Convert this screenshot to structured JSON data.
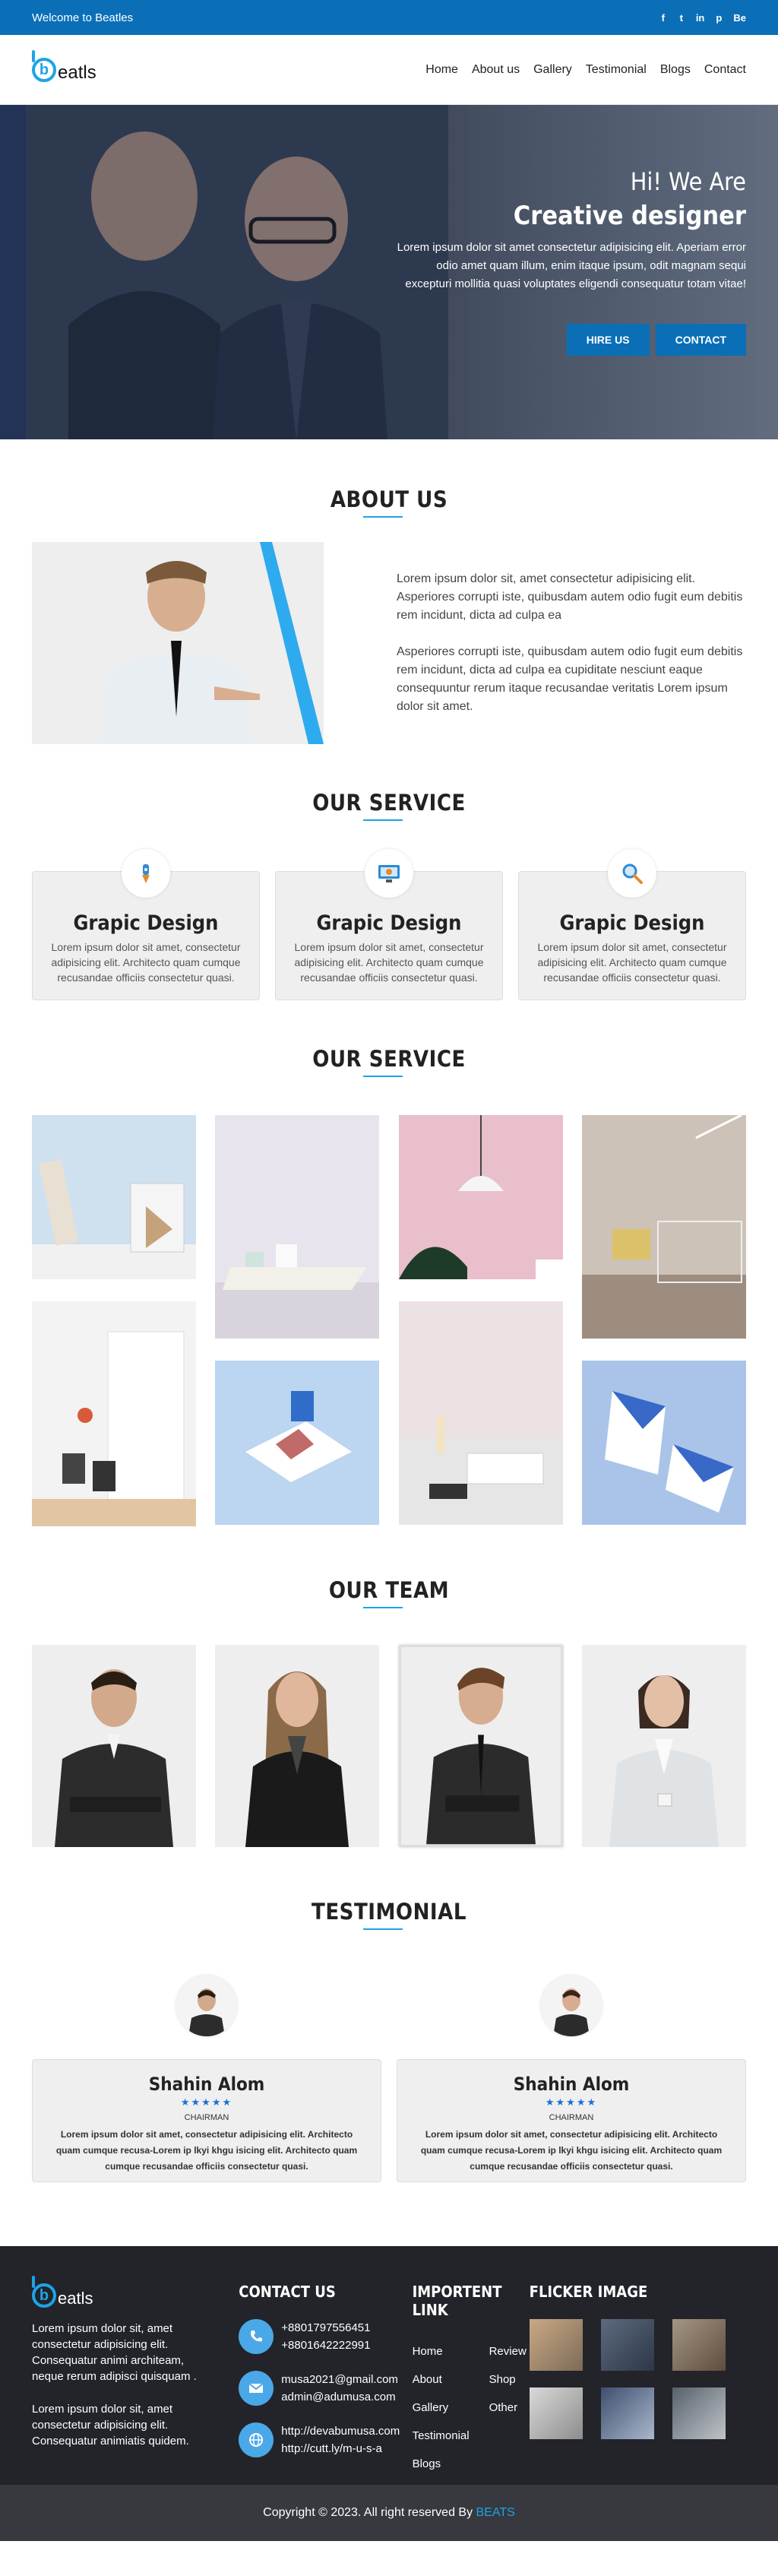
{
  "topbar": {
    "welcome": "Welcome to Beatles",
    "social": [
      "f",
      "t",
      "in",
      "p",
      "Be"
    ]
  },
  "logo": {
    "letter": "b",
    "text": "eatls"
  },
  "nav": {
    "items": [
      "Home",
      "About us",
      "Gallery",
      "Testimonial",
      "Blogs",
      "Contact"
    ]
  },
  "hero": {
    "greeting": "Hi! We Are",
    "headline": "Creative designer",
    "text": "Lorem ipsum dolor sit amet consectetur adipisicing elit. Aperiam error odio amet quam illum, enim itaque ipsum, odit magnam sequi excepturi mollitia quasi voluptates eligendi consequatur totam vitae!",
    "hire_label": "HIRE US",
    "contact_label": "CONTACT"
  },
  "about": {
    "title": "ABOUT US",
    "p1": "Lorem ipsum dolor sit, amet consectetur adipisicing elit. Asperiores corrupti iste, quibusdam autem odio fugit eum debitis rem incidunt, dicta ad culpa ea",
    "p2": "Asperiores corrupti iste, quibusdam autem odio fugit eum debitis rem incidunt, dicta ad culpa ea cupiditate nesciunt eaque consequuntur rerum itaque recusandae veritatis Lorem ipsum dolor sit amet."
  },
  "services": {
    "title": "OUR SERVICE",
    "cards": [
      {
        "icon": "pen-tool-icon",
        "title": "Grapic Design",
        "text": "Lorem ipsum dolor sit amet, consectetur adipisicing elit. Architecto quam cumque recusandae officiis consectetur quasi."
      },
      {
        "icon": "monitor-icon",
        "title": "Grapic Design",
        "text": "Lorem ipsum dolor sit amet, consectetur adipisicing elit. Architecto quam cumque recusandae officiis consectetur quasi."
      },
      {
        "icon": "magnifier-icon",
        "title": "Grapic Design",
        "text": "Lorem ipsum dolor sit amet, consectetur adipisicing elit. Architecto quam cumque recusandae officiis consectetur quasi."
      }
    ]
  },
  "gallery": {
    "title": "OUR SERVICE"
  },
  "team": {
    "title": "OUR TEAM"
  },
  "testimonial": {
    "title": "TESTIMONIAL",
    "items": [
      {
        "name": "Shahin Alom",
        "stars": "★★★★★",
        "role": "CHAIRMAN",
        "quote": "Lorem ipsum dolor sit amet, consectetur adipisicing elit. Architecto quam cumque recusa-Lorem ip lkyi khgu isicing elit. Architecto quam cumque recusandae officiis consectetur quasi."
      },
      {
        "name": "Shahin Alom",
        "stars": "★★★★★",
        "role": "CHAIRMAN",
        "quote": "Lorem ipsum dolor sit amet, consectetur adipisicing elit. Architecto quam cumque recusa-Lorem ip lkyi khgu isicing elit. Architecto quam cumque recusandae officiis consectetur quasi."
      }
    ]
  },
  "footer": {
    "logo_letter": "b",
    "logo_text": "eatls",
    "about1": "Lorem ipsum dolor sit, amet consectetur adipisicing elit. Consequatur animi architeam, neque rerum adipisci quisquam .",
    "about2": "Lorem ipsum dolor sit, amet consectetur adipisicing elit. Consequatur animiatis quidem.",
    "contact_title": "CONTACT US",
    "phone1": "+8801797556451",
    "phone2": "+8801642222991",
    "email1": "musa2021@gmail.com",
    "email2": "admin@adumusa.com",
    "web1": "http://devabumusa.com",
    "web2": "http://cutt.ly/m-u-s-a",
    "links_title": "IMPORTENT LINK",
    "links_col1": [
      "Home",
      "About",
      "Gallery",
      "Testimonial",
      "Blogs"
    ],
    "links_col2": [
      "Review",
      "Shop",
      "Other"
    ],
    "flicker_title": "FLICKER IMAGE"
  },
  "copyright": {
    "text": "Copyright © 2023. All right reserved By ",
    "brand": "BEATS"
  },
  "colors": {
    "primary": "#0b6fb8",
    "accent": "#1ea3e6",
    "footer": "#222429"
  }
}
